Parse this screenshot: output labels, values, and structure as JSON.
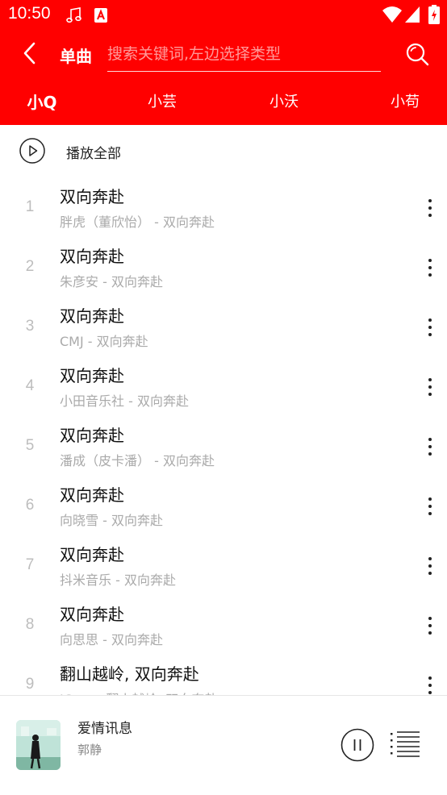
{
  "status_bar": {
    "time": "10:50"
  },
  "toolbar": {
    "type_label": "单曲",
    "search_placeholder": "搜索关键词,左边选择类型",
    "search_value": ""
  },
  "tabs": [
    {
      "label": "小Q",
      "active": true
    },
    {
      "label": "小芸",
      "active": false
    },
    {
      "label": "小沃",
      "active": false
    },
    {
      "label": "小苟",
      "active": false
    }
  ],
  "play_all_label": "播放全部",
  "songs": [
    {
      "index": "1",
      "title": "双向奔赴",
      "subtitle": "胖虎（董欣怡） - 双向奔赴"
    },
    {
      "index": "2",
      "title": "双向奔赴",
      "subtitle": "朱彦安 - 双向奔赴"
    },
    {
      "index": "3",
      "title": "双向奔赴",
      "subtitle": "CMJ - 双向奔赴"
    },
    {
      "index": "4",
      "title": "双向奔赴",
      "subtitle": "小田音乐社 - 双向奔赴"
    },
    {
      "index": "5",
      "title": "双向奔赴",
      "subtitle": "潘成（皮卡潘） - 双向奔赴"
    },
    {
      "index": "6",
      "title": "双向奔赴",
      "subtitle": "向晓雪 - 双向奔赴"
    },
    {
      "index": "7",
      "title": "双向奔赴",
      "subtitle": "抖米音乐 - 双向奔赴"
    },
    {
      "index": "8",
      "title": "双向奔赴",
      "subtitle": "向思思 - 双向奔赴"
    },
    {
      "index": "9",
      "title": "翻山越岭, 双向奔赴",
      "subtitle": "JCom - 翻山越岭, 双向奔赴"
    }
  ],
  "player": {
    "title": "爱情讯息",
    "artist": "郭静"
  },
  "colors": {
    "accent": "#ff0000",
    "index_gray": "#bdbdbd",
    "subtitle_gray": "#aaaaaa"
  },
  "icons": [
    "music-note-icon",
    "app-notification-icon",
    "wifi-icon",
    "signal-icon",
    "battery-icon",
    "back-arrow-icon",
    "search-icon",
    "play-circle-icon",
    "more-vertical-icon",
    "pause-icon",
    "playlist-icon"
  ]
}
